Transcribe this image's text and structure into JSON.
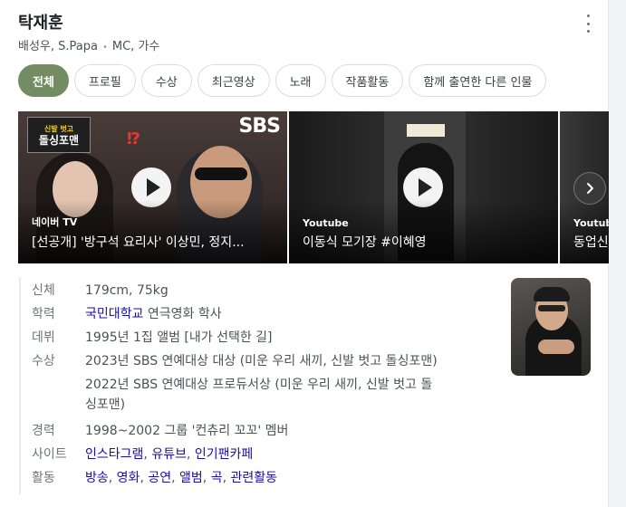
{
  "header": {
    "title": "탁재훈",
    "subtitle_names": "배성우, S.Papa",
    "subtitle_roles": "MC, 가수"
  },
  "chips": [
    {
      "label": "전체",
      "active": true
    },
    {
      "label": "프로필",
      "active": false
    },
    {
      "label": "수상",
      "active": false
    },
    {
      "label": "최근영상",
      "active": false
    },
    {
      "label": "노래",
      "active": false
    },
    {
      "label": "작품활동",
      "active": false
    },
    {
      "label": "함께 출연한 다른 인물",
      "active": false
    }
  ],
  "videos": [
    {
      "source": "네이버 TV",
      "title": "[선공개] '방구석 요리사' 이상민, 정지...",
      "thumb_badge": "SBS",
      "thumb_logo_top": "신발 벗고",
      "thumb_logo_main": "돌싱포맨"
    },
    {
      "source": "Youtube",
      "title": "이동식 모기장 #이혜영"
    },
    {
      "source": "Youtube",
      "title": "동업신"
    }
  ],
  "next_icon": "chevron-right-icon",
  "info": {
    "height_label": "신체",
    "height_value": "179cm, 75kg",
    "edu_label": "학력",
    "edu_link": "국민대학교",
    "edu_rest": " 연극영화 학사",
    "debut_label": "데뷔",
    "debut_value": "1995년 1집 앨범 [내가 선택한 길]",
    "award_label": "수상",
    "award_1": "2023년 SBS 연예대상 대상 (미운 우리 새끼, 신발 벗고 돌싱포맨)",
    "award_2a": "2022년 SBS 연예대상 프로듀서상 (미운 우리 새끼, 신발 벗고 돌",
    "award_2b": "싱포맨)",
    "career_label": "경력",
    "career_value": "1998~2002 그룹 '컨츄리 꼬꼬' 멤버",
    "site_label": "사이트",
    "site_links": [
      "인스타그램",
      "유튜브",
      "인기팬카페"
    ],
    "activity_label": "활동",
    "activity_links": [
      "방송",
      "영화",
      "공연",
      "앨범",
      "곡",
      "관련활동"
    ]
  },
  "colors": {
    "chip_active": "#738c63",
    "link": "#1a0dab"
  }
}
